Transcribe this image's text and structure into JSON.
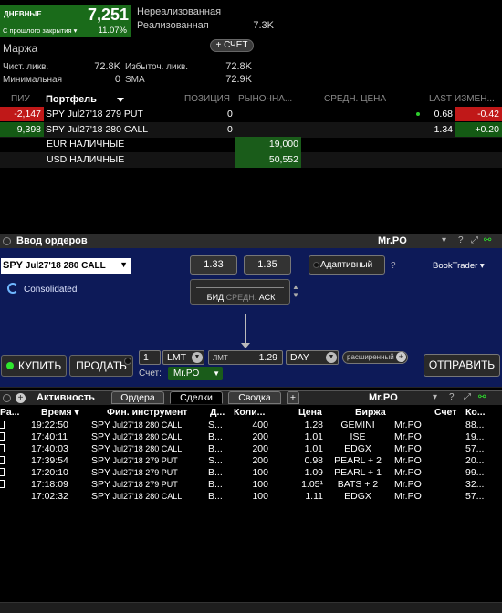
{
  "portfolio": {
    "daily_label": "ДНЕВНЫЕ",
    "daily_value": "7,251",
    "since_close_label": "С прошлого закрытия ▾",
    "daily_pct": "11.07%",
    "unrealized_label": "Нереализованная",
    "realized_label": "Реализованная",
    "realized_value": "7.3K",
    "margin_label": "Маржа",
    "account_button": "+ СЧЕТ",
    "net_liq_label": "Чист. ликв.",
    "net_liq_value": "72.8K",
    "excess_liq_label": "Избыточ. ликв.",
    "excess_liq_value": "72.8K",
    "min_label": "Минимальная",
    "min_value": "0",
    "sma_label": "SMA",
    "sma_value": "72.9K",
    "headers": {
      "daily_pl": "ПИУ",
      "portfolio": "Портфель",
      "position": "ПОЗИЦИЯ",
      "market": "РЫНОЧНА...",
      "avg_price": "СРЕДН. ЦЕНА",
      "last": "LAST",
      "change": "ИЗМЕН..."
    },
    "rows": [
      {
        "pl": "-2,147",
        "symbol": "SPY Jul27'18 279 PUT",
        "position": "0",
        "last": "0.68",
        "change": "-0.42"
      },
      {
        "pl": "9,398",
        "symbol": "SPY Jul27'18 280 CALL",
        "position": "0",
        "last": "1.34",
        "change": "+0.20"
      }
    ],
    "cash": [
      {
        "label": "EUR НАЛИЧНЫЕ",
        "value": "19,000"
      },
      {
        "label": "USD НАЛИЧНЫЕ",
        "value": "50,552"
      }
    ]
  },
  "order_entry": {
    "title": "Ввод ордеров",
    "user": "Mr.PO",
    "window_icons": [
      "+",
      "▾",
      "?",
      "⤢",
      "⚯"
    ],
    "symbol_underlying": "SPY",
    "symbol_detail": " Jul27'18 280 CALL",
    "consolidated": "Consolidated",
    "bid_price": "1.33",
    "ask_price": "1.35",
    "bid_label": "БИД",
    "mid_label": "СРЕДН.",
    "ask_label": "АСК",
    "adaptive": "Адаптивный",
    "help": "?",
    "booktrader": "BookTrader ▾",
    "buy": "КУПИТЬ",
    "sell": "ПРОДАТЬ",
    "quantity": "1",
    "order_type": "LMT",
    "limit_label": "ЛМТ",
    "limit_price": "1.29",
    "tif": "DAY",
    "extended": "расширенный",
    "account_label": "Счет:",
    "account": "Mr.PO",
    "send": "ОТПРАВИТЬ"
  },
  "activity": {
    "title": "Активность",
    "user": "Mr.PO",
    "tabs": [
      "Ордера",
      "Сделки",
      "Сводка",
      "+"
    ],
    "active_tab": "Сделки",
    "headers": {
      "flag": "Ра...",
      "time": "Время ▾",
      "instrument": "Фин. инструмент",
      "action": "Д...",
      "qty": "Коли...",
      "price": "Цена",
      "exchange": "Биржа",
      "account": "Счет",
      "commission": "Ко..."
    },
    "rows": [
      {
        "time": "19:22:50",
        "underlying": "SPY",
        "detail": " Jul27'18 280 CALL",
        "action": "S...",
        "qty": "400",
        "price": "1.28",
        "exchange": "GEMINI",
        "account": "Mr.PO",
        "comm": "88..."
      },
      {
        "time": "17:40:11",
        "underlying": "SPY",
        "detail": " Jul27'18 280 CALL",
        "action": "B...",
        "qty": "200",
        "price": "1.01",
        "exchange": "ISE",
        "account": "Mr.PO",
        "comm": "19..."
      },
      {
        "time": "17:40:03",
        "underlying": "SPY",
        "detail": " Jul27'18 280 CALL",
        "action": "B...",
        "qty": "200",
        "price": "1.01",
        "exchange": "EDGX",
        "account": "Mr.PO",
        "comm": "57..."
      },
      {
        "time": "17:39:54",
        "underlying": "SPY",
        "detail": " Jul27'18 279 PUT",
        "action": "S...",
        "qty": "200",
        "price": "0.98",
        "exchange": "PEARL + 2",
        "account": "Mr.PO",
        "comm": "20..."
      },
      {
        "time": "17:20:10",
        "underlying": "SPY",
        "detail": " Jul27'18 279 PUT",
        "action": "B...",
        "qty": "100",
        "price": "1.09",
        "exchange": "PEARL + 1",
        "account": "Mr.PO",
        "comm": "99..."
      },
      {
        "time": "17:18:09",
        "underlying": "SPY",
        "detail": " Jul27'18 279 PUT",
        "action": "B...",
        "qty": "100",
        "price": "1.05¹",
        "exchange": "BATS + 2",
        "account": "Mr.PO",
        "comm": "32..."
      },
      {
        "time": "17:02:32",
        "underlying": "SPY",
        "detail": " Jul27'18 280 CALL",
        "action": "B...",
        "qty": "100",
        "price": "1.11",
        "exchange": "EDGX",
        "account": "Mr.PO",
        "comm": "57..."
      }
    ]
  }
}
